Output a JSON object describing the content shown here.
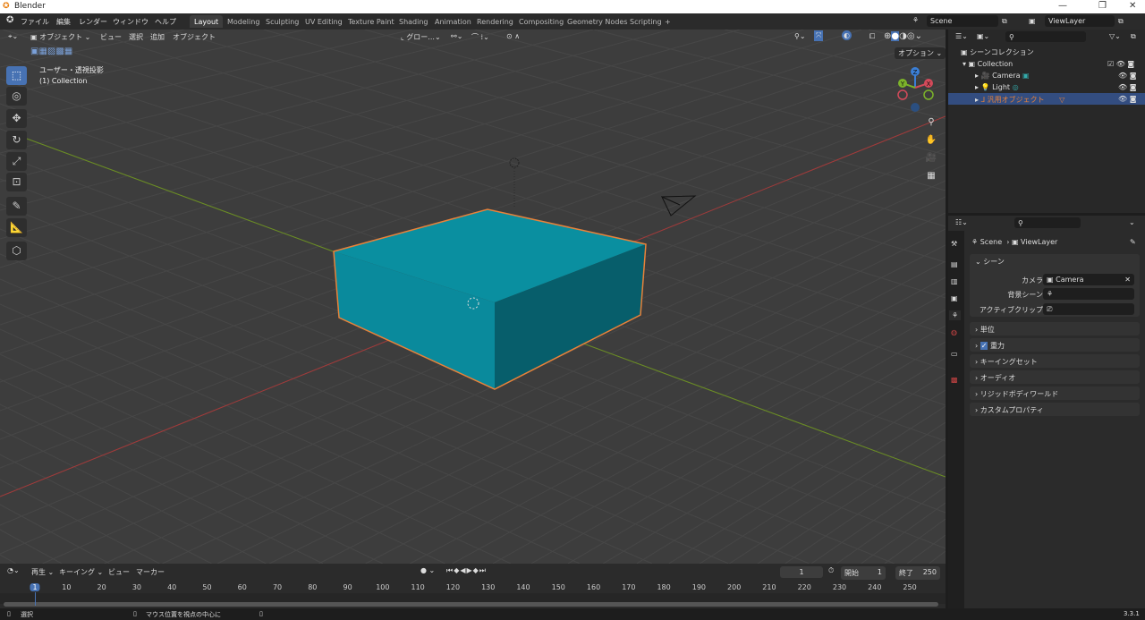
{
  "window": {
    "title": "Blender"
  },
  "menu": [
    "ファイル",
    "編集",
    "レンダー",
    "ウィンドウ",
    "ヘルプ"
  ],
  "workspaces": [
    "Layout",
    "Modeling",
    "Sculpting",
    "UV Editing",
    "Texture Paint",
    "Shading",
    "Animation",
    "Rendering",
    "Compositing",
    "Geometry Nodes",
    "Scripting",
    "+"
  ],
  "scene": "Scene",
  "view_layer": "ViewLayer",
  "viewport": {
    "mode": "オブジェクト",
    "menus": [
      "ビュー",
      "選択",
      "追加",
      "オブジェクト"
    ],
    "transform": "グロー...",
    "view_label": "ユーザー・透視投影",
    "collection_label": "(1) Collection",
    "options": "オプション",
    "gizmo": {
      "z": "Z",
      "y": "Y",
      "x": "X"
    }
  },
  "outliner": {
    "root": "シーンコレクション",
    "collection": "Collection",
    "items": [
      {
        "name": "Camera",
        "color": "#d6d6d6"
      },
      {
        "name": "Light",
        "color": "#d6d6d6"
      },
      {
        "name": "汎用オブジェクト",
        "color": "#e8823a"
      }
    ]
  },
  "properties": {
    "breadcrumb_scene": "Scene",
    "breadcrumb_layer": "ViewLayer",
    "section": "シーン",
    "camera_label": "カメラ",
    "camera_value": "Camera",
    "bg_label": "背景シーン",
    "clip_label": "アクティブクリップ",
    "panels": [
      "単位",
      "重力",
      "キーイングセット",
      "オーディオ",
      "リジッドボディワールド",
      "カスタムプロパティ"
    ],
    "gravity_checked": true
  },
  "timeline": {
    "menus": [
      "再生",
      "キーイング",
      "ビュー",
      "マーカー"
    ],
    "current_frame": "1",
    "start_label": "開始",
    "start": "1",
    "end_label": "終了",
    "end": "250",
    "ticks": [
      1,
      10,
      20,
      30,
      40,
      50,
      60,
      70,
      80,
      90,
      100,
      110,
      120,
      130,
      140,
      150,
      160,
      170,
      180,
      190,
      200,
      210,
      220,
      230,
      240,
      250
    ]
  },
  "status": {
    "select": "選択",
    "center": "マウス位置を視点の中心に",
    "version": "3.3.1"
  },
  "colors": {
    "accent": "#4772b3",
    "cube": "#0a8fa0",
    "selection": "#e8823a"
  }
}
